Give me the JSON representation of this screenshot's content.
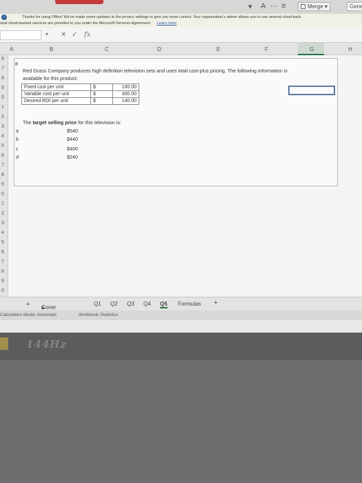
{
  "toolbar": {
    "merge_label": "Merge",
    "general_label": "Gene"
  },
  "notice": {
    "line1": "Thanks for using Office! We've made some updates to the privacy settings to give you more control. Your organization's admin allows you to use several cloud-back",
    "line2": "onal cloud-backed services are provided to you under the Microsoft Services Agreement.",
    "learn_more": "Learn more"
  },
  "formula_bar": {
    "fx": "fx"
  },
  "columns": [
    "A",
    "B",
    "C",
    "D",
    "E",
    "F",
    "G",
    "H"
  ],
  "rows": [
    "6",
    "7",
    "8",
    "9",
    "0",
    "1",
    "2",
    "3",
    "4",
    "5",
    "6",
    "7",
    "8",
    "9",
    "0",
    "1",
    "2",
    "3",
    "4",
    "5",
    "6",
    "7",
    "8",
    "9",
    "0"
  ],
  "problem": {
    "number": "8",
    "text": "Red Grass Company produces high definition television sets and uses total cost-plus pricing. The following information is available for this product:",
    "table": [
      {
        "label": "Fixed cost per unit",
        "currency": "$",
        "value": "100.00"
      },
      {
        "label": "Variable cost per unit",
        "currency": "$",
        "value": "300.00"
      },
      {
        "label": "Desired ROI per unit",
        "currency": "$",
        "value": "140.00"
      }
    ],
    "question_prefix": "The ",
    "question_bold": "target selling price",
    "question_suffix": " for this television is:",
    "options": [
      {
        "letter": "a",
        "value": "$540"
      },
      {
        "letter": "b",
        "value": "$440"
      },
      {
        "letter": "c",
        "value": "$400"
      },
      {
        "letter": "d",
        "value": "$240"
      }
    ]
  },
  "sheet_tabs": {
    "menu": "≡",
    "cover": "Cover Sheet",
    "tabs": [
      "Q1",
      "Q2",
      "Q3",
      "Q4",
      "Q5",
      "Formulas"
    ],
    "add": "+"
  },
  "status": {
    "calc_mode": "Calculation Mode: Automatic",
    "workbook_stats": "Workbook Statistics"
  },
  "taskbar": {
    "logo": "144Hz"
  }
}
